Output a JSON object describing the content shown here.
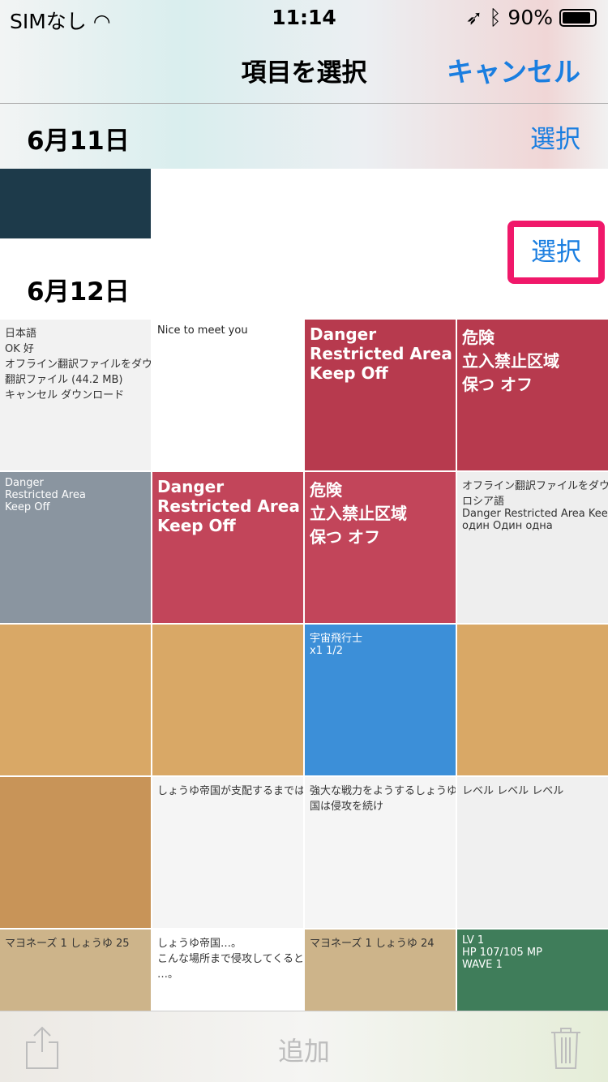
{
  "status": {
    "carrier": "SIMなし",
    "time": "11:14",
    "battery": "90%",
    "battery_level": 0.9
  },
  "nav": {
    "title": "項目を選択",
    "cancel": "キャンセル"
  },
  "sections": [
    {
      "date": "6月11日",
      "select": "選択"
    },
    {
      "date": "6月12日",
      "select": "選択"
    }
  ],
  "thumb_first": {
    "color": "#1d3a4a"
  },
  "thumbs": [
    {
      "color": "#f2f2f2",
      "fg": "#333",
      "lines": [
        "日本語",
        "OK 好",
        "オフライン翻訳ファイルをダウンロード",
        "翻訳ファイル (44.2 MB)",
        "キャンセル  ダウンロード"
      ]
    },
    {
      "color": "#ffffff",
      "fg": "#222",
      "lines": [
        "",
        "",
        "",
        "",
        "",
        "Nice to meet you"
      ]
    },
    {
      "color": "#b73a4e",
      "fg": "#fff",
      "lines": [
        "Danger",
        "Restricted Area",
        "Keep Off"
      ]
    },
    {
      "color": "#b73a4e",
      "fg": "#fff",
      "lines": [
        "危険",
        "立入禁止区域",
        "保つ オフ"
      ]
    },
    {
      "color": "#8a95a0",
      "fg": "#fff",
      "lines": [
        "",
        "",
        "",
        "Danger",
        "Restricted Area",
        "Keep Off"
      ]
    },
    {
      "color": "#c2455a",
      "fg": "#fff",
      "lines": [
        "",
        "Danger",
        "Restricted Area",
        "Keep Off"
      ]
    },
    {
      "color": "#c2455a",
      "fg": "#fff",
      "lines": [
        "",
        "危険",
        "立入禁止区域",
        "保つ オフ"
      ]
    },
    {
      "color": "#eeeeee",
      "fg": "#333",
      "lines": [
        "オフライン翻訳ファイルをダウンロード",
        "ロシア語",
        "Danger Restricted Area Keep Off",
        "один  Один  одна"
      ]
    },
    {
      "color": "#d9a866",
      "fg": "#fff",
      "lines": []
    },
    {
      "color": "#d9a866",
      "fg": "#fff",
      "lines": []
    },
    {
      "color": "#3c8fd8",
      "fg": "#fff",
      "lines": [
        "宇宙飛行士",
        "x1  1/2"
      ]
    },
    {
      "color": "#d9a866",
      "fg": "#fff",
      "lines": []
    },
    {
      "color": "#c89458",
      "fg": "#fff",
      "lines": []
    },
    {
      "color": "#f5f5f5",
      "fg": "#333",
      "lines": [
        "",
        "",
        "",
        "",
        "しょうゆ帝国が支配するまでは…。"
      ]
    },
    {
      "color": "#f5f5f5",
      "fg": "#333",
      "lines": [
        "",
        "",
        "",
        "",
        "強大な戦力をようするしょうゆ帝",
        "国は侵攻を続け"
      ]
    },
    {
      "color": "#f0f0f0",
      "fg": "#333",
      "lines": [
        "",
        "",
        "",
        "",
        "",
        "",
        "",
        "レベル レベル レベル"
      ]
    },
    {
      "color": "#cdb48a",
      "fg": "#333",
      "lines": [
        "マヨネーズ  1  しょうゆ  25"
      ]
    },
    {
      "color": "#ffffff",
      "fg": "#333",
      "lines": [
        "",
        "",
        "しょうゆ帝国…。",
        "こんな場所まで侵攻してくるとは",
        "…。"
      ]
    },
    {
      "color": "#cdb48a",
      "fg": "#333",
      "lines": [
        "マヨネーズ  1  しょうゆ  24"
      ]
    },
    {
      "color": "#3f7d5a",
      "fg": "#fff",
      "lines": [
        "LV 1",
        "HP 107/105  MP",
        "WAVE 1"
      ]
    }
  ],
  "toolbar": {
    "add": "追加"
  }
}
